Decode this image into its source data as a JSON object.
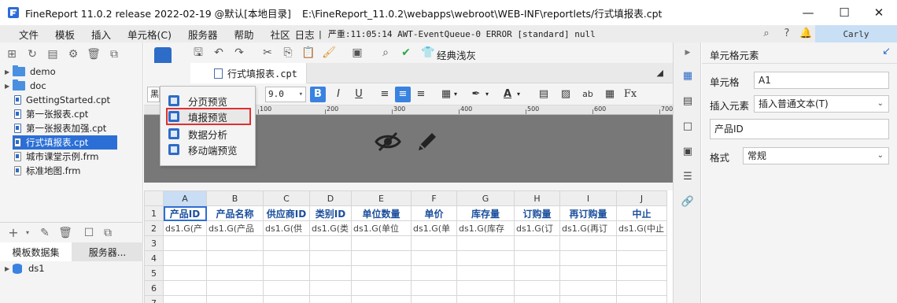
{
  "window": {
    "app_title": "FineReport 11.0.2 release 2022-02-19 @默认[本地目录]",
    "file_path": "E:\\FineReport_11.0.2\\webapps\\webroot\\WEB-INF\\reportlets/行式填报表.cpt",
    "minimize": "—",
    "maximize": "☐",
    "close": "✕"
  },
  "menubar": {
    "items": [
      "文件",
      "模板",
      "插入",
      "单元格(C)",
      "服务器",
      "帮助",
      "社区",
      "日志"
    ],
    "status": "| 严重:11:05:14 AWT-EventQueue-0 ERROR [standard] null",
    "user": "Carly"
  },
  "left_panel": {
    "tree": [
      {
        "label": "demo",
        "type": "folder"
      },
      {
        "label": "doc",
        "type": "folder"
      },
      {
        "label": "GettingStarted.cpt",
        "type": "file"
      },
      {
        "label": "第一张报表.cpt",
        "type": "file"
      },
      {
        "label": "第一张报表加强.cpt",
        "type": "file"
      },
      {
        "label": "行式填报表.cpt",
        "type": "file",
        "selected": true
      },
      {
        "label": "城市课堂示例.frm",
        "type": "file"
      },
      {
        "label": "标准地图.frm",
        "type": "file"
      }
    ],
    "tabs": [
      "模板数据集",
      "服务器..."
    ],
    "datasets": [
      "ds1"
    ]
  },
  "toolbar": {
    "style_label": "经典浅灰"
  },
  "document_tab": {
    "title": "行式填报表.cpt"
  },
  "format_bar": {
    "font_value": "黑",
    "size_value": "9.0",
    "bold": "B",
    "italic": "I",
    "underline": "U",
    "text_ab": "ab",
    "formula": "Fx"
  },
  "ruler": {
    "labels": [
      "100",
      "200",
      "300",
      "400",
      "500",
      "600",
      "700"
    ]
  },
  "preview_menu": {
    "items": [
      "分页预览",
      "填报预览",
      "数据分析",
      "移动端预览"
    ],
    "highlighted": "填报预览"
  },
  "sheet": {
    "columns": [
      "A",
      "B",
      "C",
      "D",
      "E",
      "F",
      "G",
      "H",
      "I",
      "J"
    ],
    "row_numbers": [
      "1",
      "2",
      "3",
      "4",
      "5",
      "6",
      "7"
    ],
    "header_row": [
      "产品ID",
      "产品名称",
      "供应商ID",
      "类别ID",
      "单位数量",
      "单价",
      "库存量",
      "订购量",
      "再订购量",
      "中止"
    ],
    "data_row": [
      "ds1.G(产",
      "ds1.G(产品",
      "ds1.G(供",
      "ds1.G(类",
      "ds1.G(单位",
      "ds1.G(单",
      "ds1.G(库存",
      "ds1.G(订",
      "ds1.G(再订",
      "ds1.G(中止"
    ]
  },
  "right_panel": {
    "title": "单元格元素",
    "cell_label": "单元格",
    "cell_value": "A1",
    "insert_label": "插入元素",
    "insert_value": "插入普通文本(T)",
    "content_value": "产品ID",
    "format_label": "格式",
    "format_value": "常规"
  }
}
